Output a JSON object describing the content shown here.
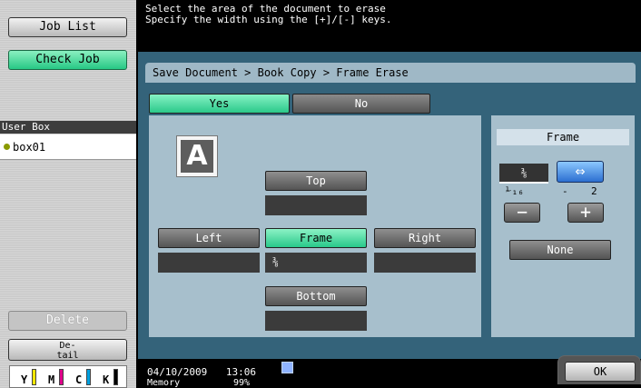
{
  "left": {
    "job_list": "Job List",
    "check_job": "Check Job",
    "user_box_header": "User Box",
    "box_item": "box01",
    "delete": "Delete",
    "detail": "De-\ntail",
    "toner": [
      "Y",
      "M",
      "C",
      "K"
    ],
    "toner_colors": [
      "#f2e600",
      "#e0008a",
      "#00a0e0",
      "#000000"
    ]
  },
  "message": {
    "line1": "Select the area of the document to erase",
    "line2": "Specify the width using the [+]/[-] keys."
  },
  "breadcrumb": "Save Document > Book Copy > Frame Erase",
  "toggle": {
    "yes": "Yes",
    "no": "No"
  },
  "content": {
    "doc_letter": "A",
    "top": "Top",
    "left": "Left",
    "frame": "Frame",
    "right": "Right",
    "bottom": "Bottom",
    "frame_value": "⅜"
  },
  "side": {
    "header": "Frame",
    "value": "⅜",
    "arrow": "⇔",
    "range_min": "⅟₁₆",
    "range_sep": "-",
    "range_max": "2",
    "minus": "−",
    "plus": "+",
    "none": "None"
  },
  "status": {
    "date": "04/10/2009",
    "time": "13:06",
    "memory": "Memory",
    "memory_pct": "99%",
    "ok": "OK"
  }
}
